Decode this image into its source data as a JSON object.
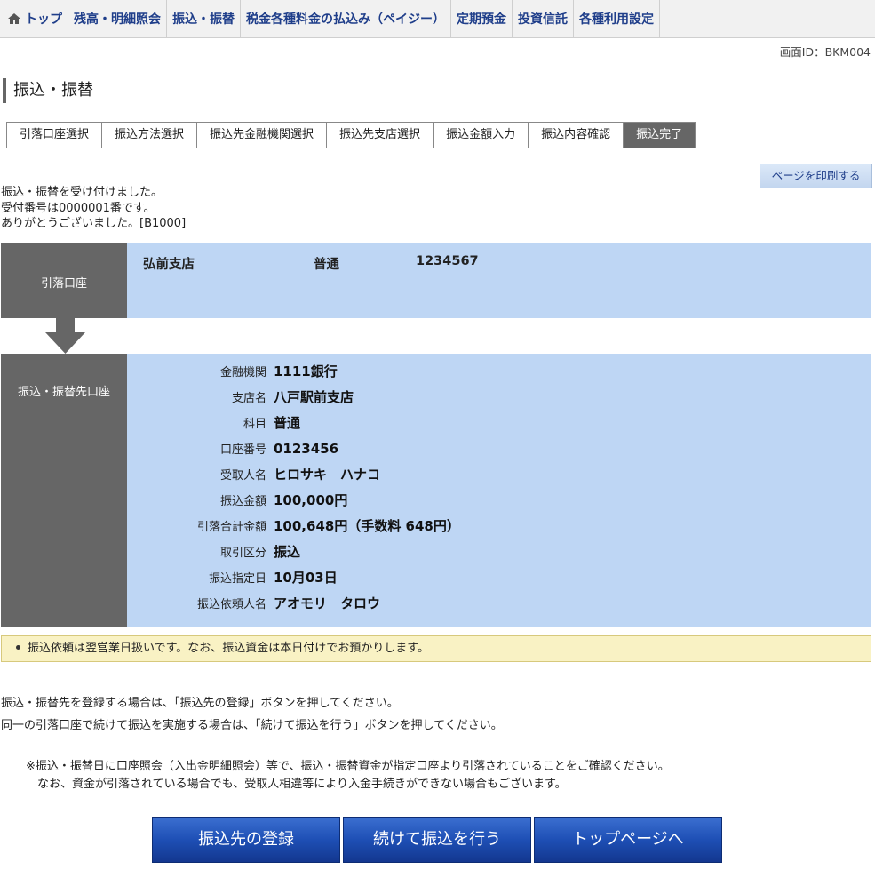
{
  "nav": {
    "items": [
      "トップ",
      "残高・明細照会",
      "振込・振替",
      "税金各種料金の払込み（ペイジー）",
      "定期預金",
      "投資信託",
      "各種利用設定"
    ]
  },
  "screen_id": "画面ID：BKM004",
  "page_title": "振込・振替",
  "steps": [
    "引落口座選択",
    "振込方法選択",
    "振込先金融機関選択",
    "振込先支店選択",
    "振込金額入力",
    "振込内容確認",
    "振込完了"
  ],
  "print_label": "ページを印刷する",
  "messages": [
    "振込・振替を受け付けました。",
    "受付番号は0000001番です。",
    "ありがとうございました。[B1000]"
  ],
  "source": {
    "label": "引落口座",
    "branch": "弘前支店",
    "type": "普通",
    "number": "1234567"
  },
  "destination": {
    "label": "振込・振替先口座",
    "rows": [
      {
        "key": "金融機関",
        "value": "1111銀行"
      },
      {
        "key": "支店名",
        "value": "八戸駅前支店"
      },
      {
        "key": "科目",
        "value": "普通"
      },
      {
        "key": "口座番号",
        "value": "0123456"
      },
      {
        "key": "受取人名",
        "value": "ヒロサキ　ハナコ"
      },
      {
        "key": "振込金額",
        "value": "100,000円"
      },
      {
        "key": "引落合計金額",
        "value": "100,648円（手数料 648円）"
      },
      {
        "key": "取引区分",
        "value": "振込"
      },
      {
        "key": "振込指定日",
        "value": "10月03日"
      },
      {
        "key": "振込依頼人名",
        "value": "アオモリ　タロウ"
      }
    ]
  },
  "notice": "振込依頼は翌営業日扱いです。なお、振込資金は本日付けでお預かりします。",
  "instructions": [
    "振込・振替先を登録する場合は、「振込先の登録」ボタンを押してください。",
    "同一の引落口座で続けて振込を実施する場合は、「続けて振込を行う」ボタンを押してください。"
  ],
  "notes": [
    "※振込・振替日に口座照会（入出金明細照会）等で、振込・振替資金が指定口座より引落されていることをご確認ください。",
    "　なお、資金が引落されている場合でも、受取人相違等により入金手続きができない場合もございます。"
  ],
  "buttons": {
    "register": "振込先の登録",
    "continue": "続けて振込を行う",
    "top": "トップページへ"
  },
  "colors": {
    "nav_text": "#1f3e8a",
    "panel_bg": "#bed6f4",
    "label_bg": "#666666",
    "notice_bg": "#f9f2c4",
    "button_blue": "#1e4fb5"
  }
}
